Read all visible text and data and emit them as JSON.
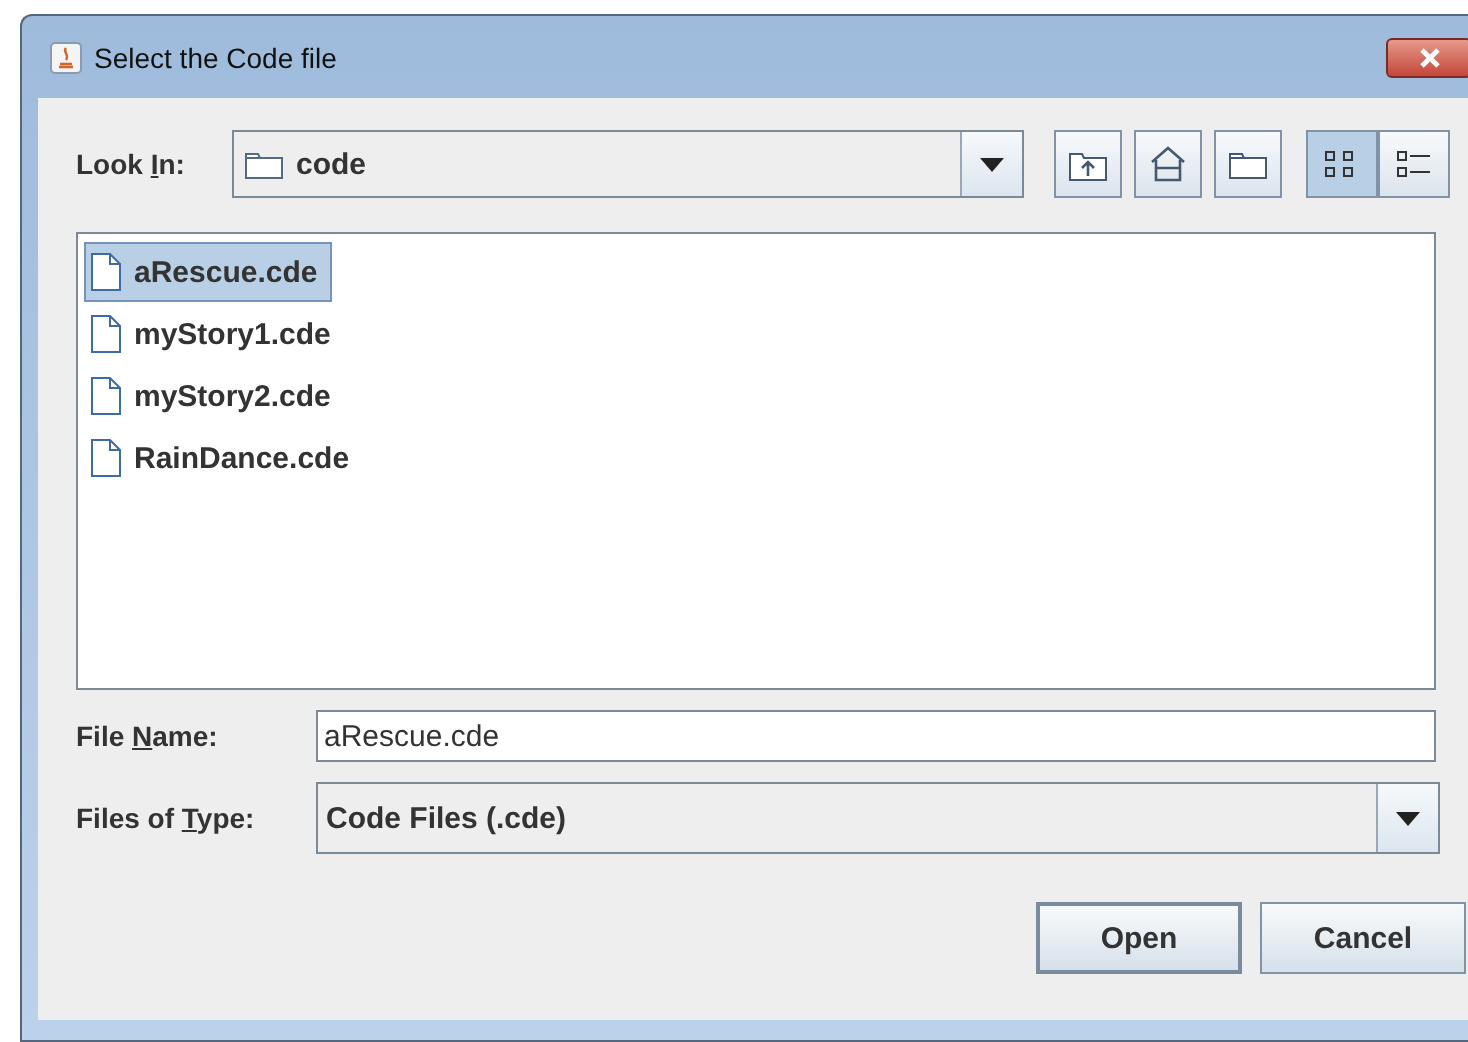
{
  "window": {
    "title": "Select the Code file"
  },
  "look_in": {
    "label": {
      "before": "Look ",
      "key": "I",
      "after": "n:"
    },
    "value": "code"
  },
  "toolbar": [
    {
      "kind": "up-folder"
    },
    {
      "kind": "home"
    },
    {
      "kind": "new-folder"
    }
  ],
  "view_modes": [
    {
      "kind": "list",
      "selected": true
    },
    {
      "kind": "details",
      "selected": false
    }
  ],
  "files": [
    {
      "name": "aRescue.cde",
      "selected": true
    },
    {
      "name": "myStory1.cde",
      "selected": false
    },
    {
      "name": "myStory2.cde",
      "selected": false
    },
    {
      "name": "RainDance.cde",
      "selected": false
    }
  ],
  "file_name": {
    "label": {
      "before": "File ",
      "key": "N",
      "after": "ame:"
    },
    "value": "aRescue.cde"
  },
  "files_of_type": {
    "label": {
      "before": "Files of ",
      "key": "T",
      "after": "ype:"
    },
    "value": "Code Files (.cde)"
  },
  "buttons": [
    "Open",
    "Cancel"
  ]
}
